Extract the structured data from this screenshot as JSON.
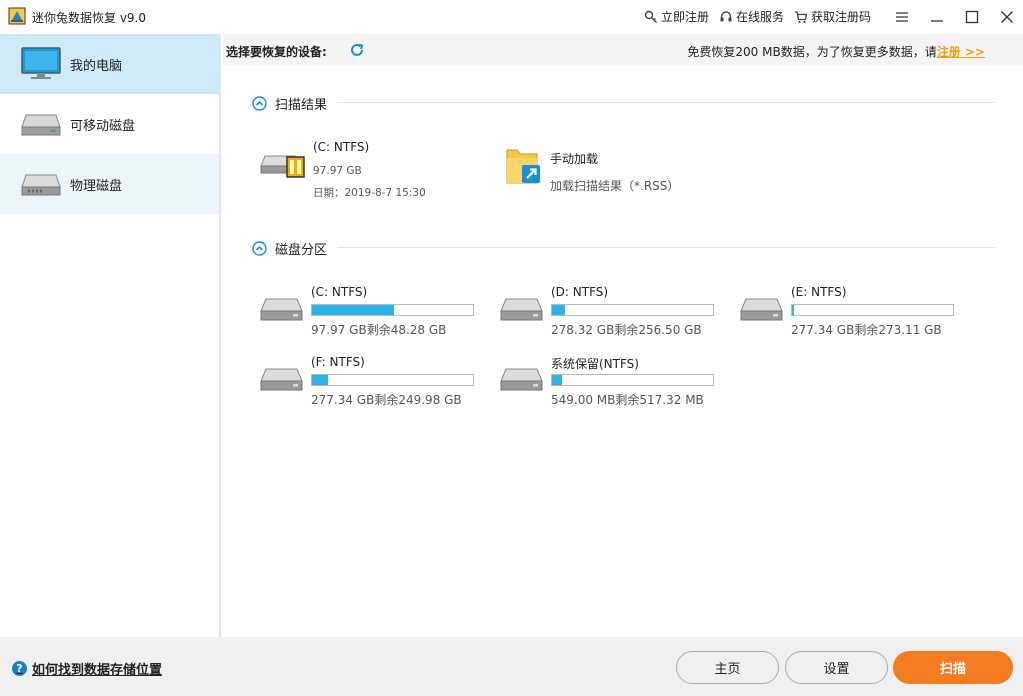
{
  "window": {
    "title": "迷你兔数据恢复 v9.0",
    "actions": {
      "register": "立即注册",
      "online_service": "在线服务",
      "get_code": "获取注册码"
    }
  },
  "sidebar": {
    "items": [
      {
        "label": "我的电脑",
        "icon": "monitor-icon"
      },
      {
        "label": "可移动磁盘",
        "icon": "removable-drive-icon"
      },
      {
        "label": "物理磁盘",
        "icon": "physical-disk-icon"
      }
    ]
  },
  "toolbar": {
    "label": "选择要恢复的设备:",
    "promo_text": "免费恢复200 MB数据，为了恢复更多数据，请",
    "promo_link": "注册 >>"
  },
  "sections": {
    "scan_results": "扫描结果",
    "partitions": "磁盘分区"
  },
  "scan_results": [
    {
      "name": "(C: NTFS)",
      "size": "97.97 GB",
      "date": "日期：2019-8-7 15:30"
    },
    {
      "name": "手动加载",
      "sub": "加载扫描结果（*.RSS）"
    }
  ],
  "partitions": [
    {
      "name": "(C: NTFS)",
      "size_text": "97.97 GB剩余48.28 GB",
      "used_fraction": 0.51
    },
    {
      "name": "(D: NTFS)",
      "size_text": "278.32 GB剩余256.50 GB",
      "used_fraction": 0.08
    },
    {
      "name": "(E: NTFS)",
      "size_text": "277.34 GB剩余273.11 GB",
      "used_fraction": 0.015
    },
    {
      "name": "(F: NTFS)",
      "size_text": "277.34 GB剩余249.98 GB",
      "used_fraction": 0.1
    },
    {
      "name": "系统保留(NTFS)",
      "size_text": "549.00 MB剩余517.32 MB",
      "used_fraction": 0.06
    }
  ],
  "bottom": {
    "help": "如何找到数据存储位置",
    "home": "主页",
    "settings": "设置",
    "scan": "扫描"
  },
  "colors": {
    "accent": "#2bb3e8",
    "primary_button": "#f47b20",
    "link": "#f39c1a",
    "sidebar_active": "#cdeaf6"
  }
}
